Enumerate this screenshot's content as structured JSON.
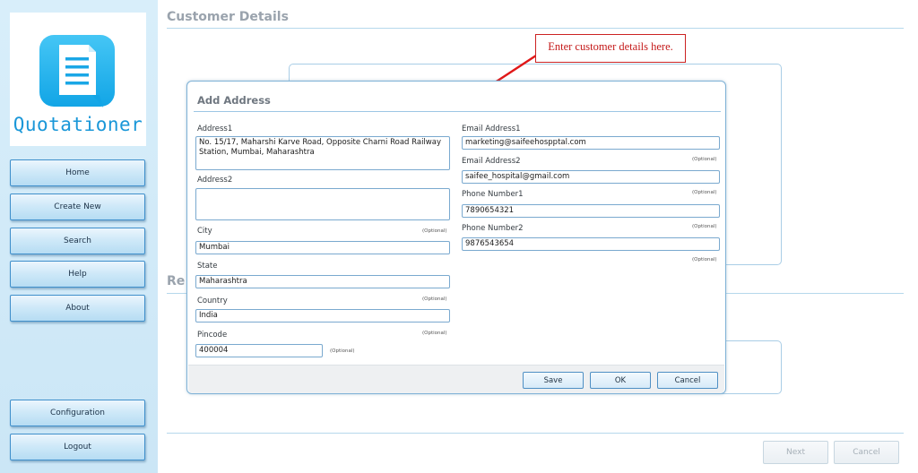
{
  "app": {
    "name": "Quotationer"
  },
  "sidebar": {
    "items": [
      {
        "label": "Home"
      },
      {
        "label": "Create New"
      },
      {
        "label": "Search"
      },
      {
        "label": "Help"
      },
      {
        "label": "About"
      }
    ],
    "bottom_items": [
      {
        "label": "Configuration"
      },
      {
        "label": "Logout"
      }
    ]
  },
  "main": {
    "section_title": "Customer Details",
    "section2_title_partial": "Re",
    "footer": {
      "next_label": "Next",
      "cancel_label": "Cancel"
    }
  },
  "annotation": {
    "text": "Enter customer details here.",
    "color": "#cc2222"
  },
  "dialog": {
    "title": "Add Address",
    "optional_text": "(Optional)",
    "left": {
      "address1": {
        "label": "Address1",
        "value": "No. 15/17, Maharshi Karve Road, Opposite Charni Road Railway Station, Mumbai, Maharashtra"
      },
      "address2": {
        "label": "Address2",
        "value": ""
      },
      "city": {
        "label": "City",
        "value": "Mumbai"
      },
      "state": {
        "label": "State",
        "value": "Maharashtra"
      },
      "country": {
        "label": "Country",
        "value": "India"
      },
      "pincode": {
        "label": "Pincode",
        "value": "400004"
      }
    },
    "right": {
      "email1": {
        "label": "Email Address1",
        "value": "marketing@saifeehospptal.com"
      },
      "email2": {
        "label": "Email Address2",
        "value": "saifee_hospital@gmail.com"
      },
      "phone1": {
        "label": "Phone Number1",
        "value": "7890654321"
      },
      "phone2": {
        "label": "Phone Number2",
        "value": "9876543654"
      }
    },
    "buttons": {
      "save": "Save",
      "ok": "OK",
      "cancel": "Cancel"
    }
  },
  "colors": {
    "accent": "#1a97d8",
    "sidebar_bg": "#d8eefa",
    "field_border": "#7aa9cf"
  }
}
